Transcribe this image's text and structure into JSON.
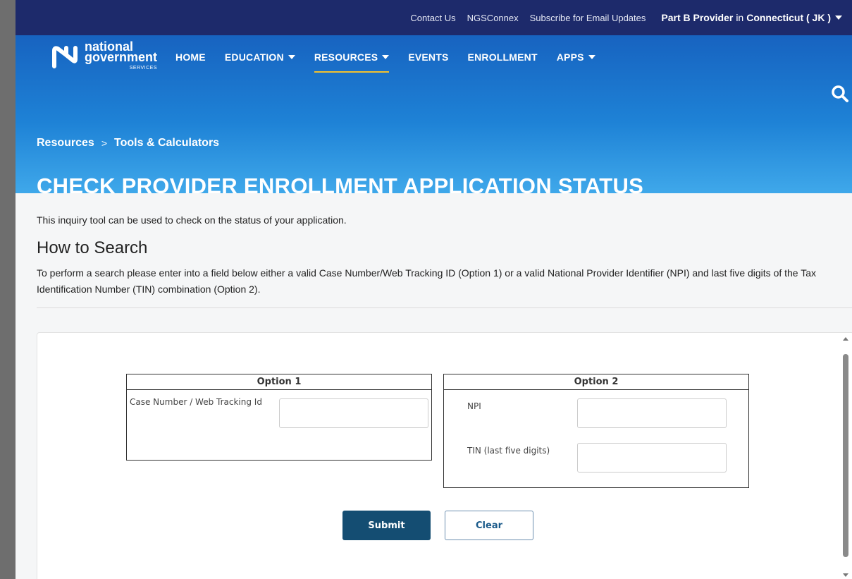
{
  "utility_bar": {
    "links": [
      "Contact Us",
      "NGSConnex",
      "Subscribe for Email Updates"
    ],
    "region_role": "Part B Provider",
    "region_in": "in",
    "region_state": "Connecticut ( JK )"
  },
  "logo": {
    "line1": "national",
    "line2": "government",
    "line3": "SERVICES"
  },
  "nav": {
    "items": [
      {
        "label": "HOME",
        "dropdown": false
      },
      {
        "label": "EDUCATION",
        "dropdown": true
      },
      {
        "label": "RESOURCES",
        "dropdown": true,
        "active": true
      },
      {
        "label": "EVENTS",
        "dropdown": false
      },
      {
        "label": "ENROLLMENT",
        "dropdown": false
      },
      {
        "label": "APPS",
        "dropdown": true
      }
    ]
  },
  "breadcrumb": {
    "parent": "Resources",
    "separator": ">",
    "current": "Tools & Calculators"
  },
  "page_title": "CHECK PROVIDER ENROLLMENT APPLICATION STATUS",
  "content": {
    "intro": "This inquiry tool can be used to check on the status of your application.",
    "how_to_heading": "How to Search",
    "instructions": "To perform a search please enter into a field below either a valid Case Number/Web Tracking ID (Option 1) or a valid National Provider Identifier (NPI) and last five digits of the Tax Identification Number (TIN) combination (Option 2)."
  },
  "form": {
    "option1": {
      "title": "Option 1",
      "case_label": "Case Number / Web Tracking Id",
      "case_value": ""
    },
    "option2": {
      "title": "Option 2",
      "npi_label": "NPI",
      "npi_value": "",
      "tin_label": "TIN (last five digits)",
      "tin_value": ""
    },
    "submit_label": "Submit",
    "clear_label": "Clear"
  },
  "colors": {
    "utility_bar": "#1d2a6b",
    "hero_top": "#1763c0",
    "hero_bottom": "#3fa8ea",
    "active_underline": "#f2c12e",
    "submit_bg": "#144d72"
  }
}
